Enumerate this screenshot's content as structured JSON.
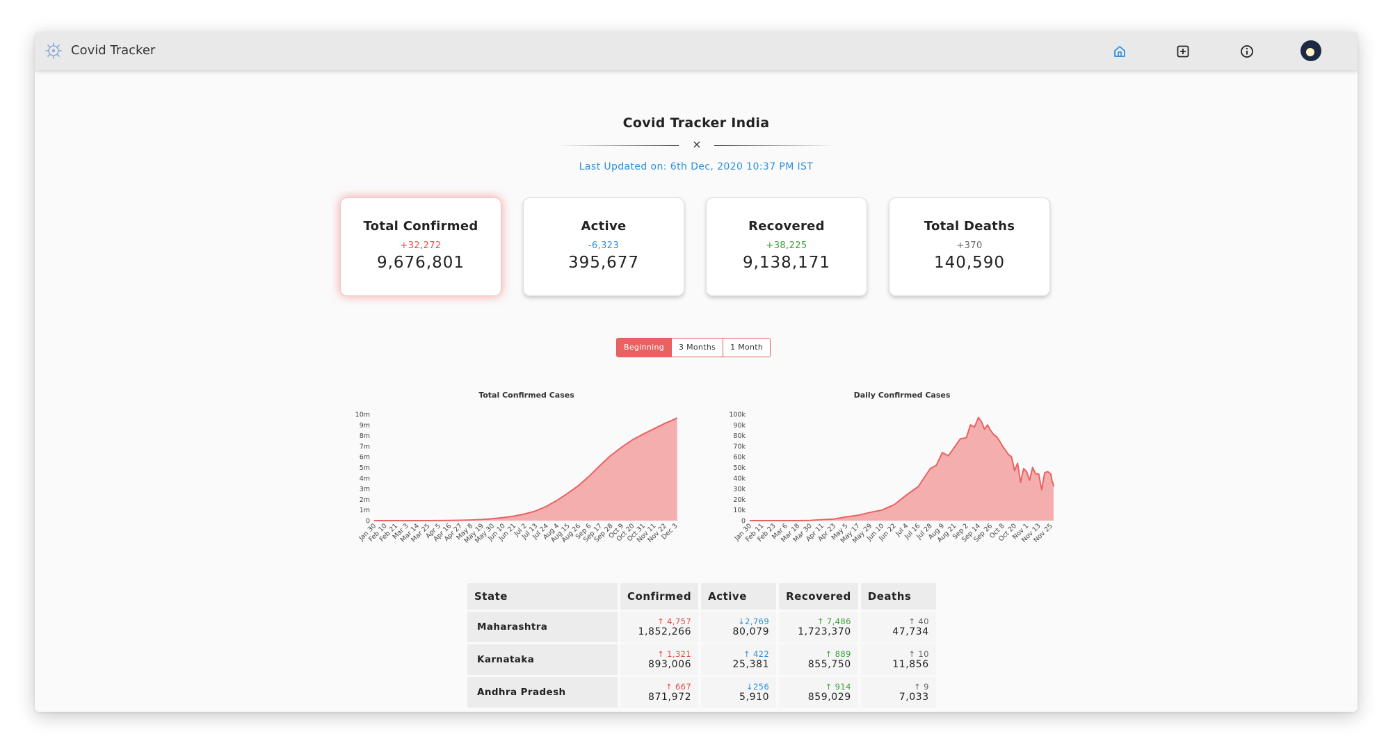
{
  "app": {
    "title": "Covid Tracker",
    "accent": "#e96262",
    "nav": [
      {
        "name": "home",
        "icon": "home-icon",
        "color": "#2d8fdd"
      },
      {
        "name": "add",
        "icon": "plus-square-icon",
        "color": "#222"
      },
      {
        "name": "info",
        "icon": "info-circle-icon",
        "color": "#222"
      }
    ],
    "avatar_icon": "theme-toggle-avatar"
  },
  "header": {
    "title": "Covid Tracker India",
    "divider_symbol": "×",
    "updated": "Last Updated on: 6th Dec, 2020 10:37 PM IST"
  },
  "cards": [
    {
      "title": "Total Confirmed",
      "delta": "+32,272",
      "value": "9,676,801",
      "delta_color": "#e74c4c",
      "active": true
    },
    {
      "title": "Active",
      "delta": "-6,323",
      "value": "395,677",
      "delta_color": "#2d8fdd",
      "active": false
    },
    {
      "title": "Recovered",
      "delta": "+38,225",
      "value": "9,138,171",
      "delta_color": "#3aa33a",
      "active": false
    },
    {
      "title": "Total Deaths",
      "delta": "+370",
      "value": "140,590",
      "delta_color": "#666666",
      "active": false
    }
  ],
  "range": {
    "options": [
      "Beginning",
      "3 Months",
      "1 Month"
    ],
    "selected": "Beginning"
  },
  "chart_data": [
    {
      "type": "area",
      "title": "Total Confirmed Cases",
      "color": "#e96262",
      "y_ticks": [
        "0",
        "1m",
        "2m",
        "3m",
        "4m",
        "5m",
        "6m",
        "7m",
        "8m",
        "9m",
        "10m"
      ],
      "ylim": [
        0,
        10000000
      ],
      "x_ticks": [
        "Jan 30",
        "Feb 10",
        "Feb 21",
        "Mar 3",
        "Mar 14",
        "Mar 25",
        "Apr 5",
        "Apr 16",
        "Apr 27",
        "May 8",
        "May 19",
        "May 30",
        "Jun 10",
        "Jun 21",
        "Jul 2",
        "Jul 13",
        "Jul 24",
        "Aug 4",
        "Aug 15",
        "Aug 26",
        "Sep 6",
        "Sep 17",
        "Sep 28",
        "Oct 9",
        "Oct 20",
        "Oct 31",
        "Nov 11",
        "Nov 22",
        "Dec 3"
      ],
      "x": [
        "Jan 30",
        "Feb 10",
        "Feb 21",
        "Mar 3",
        "Mar 14",
        "Mar 25",
        "Apr 5",
        "Apr 16",
        "Apr 27",
        "May 8",
        "May 19",
        "May 30",
        "Jun 10",
        "Jun 21",
        "Jul 2",
        "Jul 13",
        "Jul 24",
        "Aug 4",
        "Aug 15",
        "Aug 26",
        "Sep 6",
        "Sep 17",
        "Sep 28",
        "Oct 9",
        "Oct 20",
        "Oct 31",
        "Nov 11",
        "Nov 22",
        "Dec 3",
        "Dec 6"
      ],
      "values": [
        1,
        3,
        3,
        5,
        100,
        600,
        4300,
        13400,
        29500,
        59700,
        106800,
        182100,
        287200,
        426900,
        627200,
        907600,
        1336900,
        1908200,
        2589700,
        3307700,
        4202600,
        5200000,
        6143000,
        6906000,
        7597000,
        8137000,
        8638000,
        9140000,
        9571000,
        9676801
      ]
    },
    {
      "type": "area",
      "title": "Daily Confirmed Cases",
      "color": "#e96262",
      "y_ticks": [
        "0",
        "10k",
        "20k",
        "30k",
        "40k",
        "50k",
        "60k",
        "70k",
        "80k",
        "90k",
        "100k"
      ],
      "ylim": [
        0,
        100000
      ],
      "x_ticks": [
        "Jan 30",
        "Feb 11",
        "Feb 23",
        "Mar 6",
        "Mar 18",
        "Mar 30",
        "Apr 11",
        "Apr 23",
        "May 5",
        "May 17",
        "May 29",
        "Jun 10",
        "Jun 22",
        "Jul 4",
        "Jul 16",
        "Jul 28",
        "Aug 9",
        "Aug 21",
        "Sep 2",
        "Sep 14",
        "Sep 26",
        "Oct 8",
        "Oct 20",
        "Nov 1",
        "Nov 13",
        "Nov 25"
      ],
      "x": [
        "Jan 30",
        "Feb 11",
        "Feb 23",
        "Mar 6",
        "Mar 18",
        "Mar 30",
        "Apr 11",
        "Apr 23",
        "May 5",
        "May 17",
        "May 29",
        "Jun 10",
        "Jun 22",
        "Jul 4",
        "Jul 16",
        "Jul 28",
        "Aug 3",
        "Aug 9",
        "Aug 15",
        "Aug 21",
        "Aug 27",
        "Sep 2",
        "Sep 8",
        "Sep 11",
        "Sep 14",
        "Sep 17",
        "Sep 20",
        "Sep 23",
        "Sep 26",
        "Sep 29",
        "Oct 2",
        "Oct 5",
        "Oct 8",
        "Oct 11",
        "Oct 14",
        "Oct 17",
        "Oct 20",
        "Oct 23",
        "Oct 26",
        "Oct 29",
        "Nov 1",
        "Nov 4",
        "Nov 7",
        "Nov 10",
        "Nov 13",
        "Nov 16",
        "Nov 19",
        "Nov 22",
        "Nov 25",
        "Nov 28",
        "Dec 1",
        "Dec 4",
        "Dec 6"
      ],
      "values": [
        0,
        0,
        0,
        5,
        30,
        200,
        900,
        1500,
        3500,
        5000,
        7700,
        10000,
        15000,
        24000,
        32000,
        49000,
        52000,
        64000,
        61000,
        69000,
        77000,
        78000,
        90000,
        88000,
        97000,
        93000,
        86000,
        90000,
        85000,
        81000,
        79000,
        75000,
        70000,
        66000,
        62000,
        60000,
        47000,
        54000,
        36000,
        49000,
        46000,
        38000,
        50000,
        44000,
        44000,
        29000,
        45000,
        46000,
        44000,
        41000,
        36000,
        36000,
        32000
      ]
    }
  ],
  "table": {
    "headers": [
      "State",
      "Confirmed",
      "Active",
      "Recovered",
      "Deaths"
    ],
    "rows": [
      {
        "state": "Maharashtra",
        "confirmed_delta": "↑ 4,757",
        "confirmed": "1,852,266",
        "active_delta": "↓2,769",
        "active": "80,079",
        "recovered_delta": "↑ 7,486",
        "recovered": "1,723,370",
        "deaths_delta": "↑ 40",
        "deaths": "47,734"
      },
      {
        "state": "Karnataka",
        "confirmed_delta": "↑ 1,321",
        "confirmed": "893,006",
        "active_delta": "↑ 422",
        "active": "25,381",
        "recovered_delta": "↑ 889",
        "recovered": "855,750",
        "deaths_delta": "↑ 10",
        "deaths": "11,856"
      },
      {
        "state": "Andhra Pradesh",
        "confirmed_delta": "↑ 667",
        "confirmed": "871,972",
        "active_delta": "↓256",
        "active": "5,910",
        "recovered_delta": "↑ 914",
        "recovered": "859,029",
        "deaths_delta": "↑ 9",
        "deaths": "7,033"
      }
    ]
  }
}
